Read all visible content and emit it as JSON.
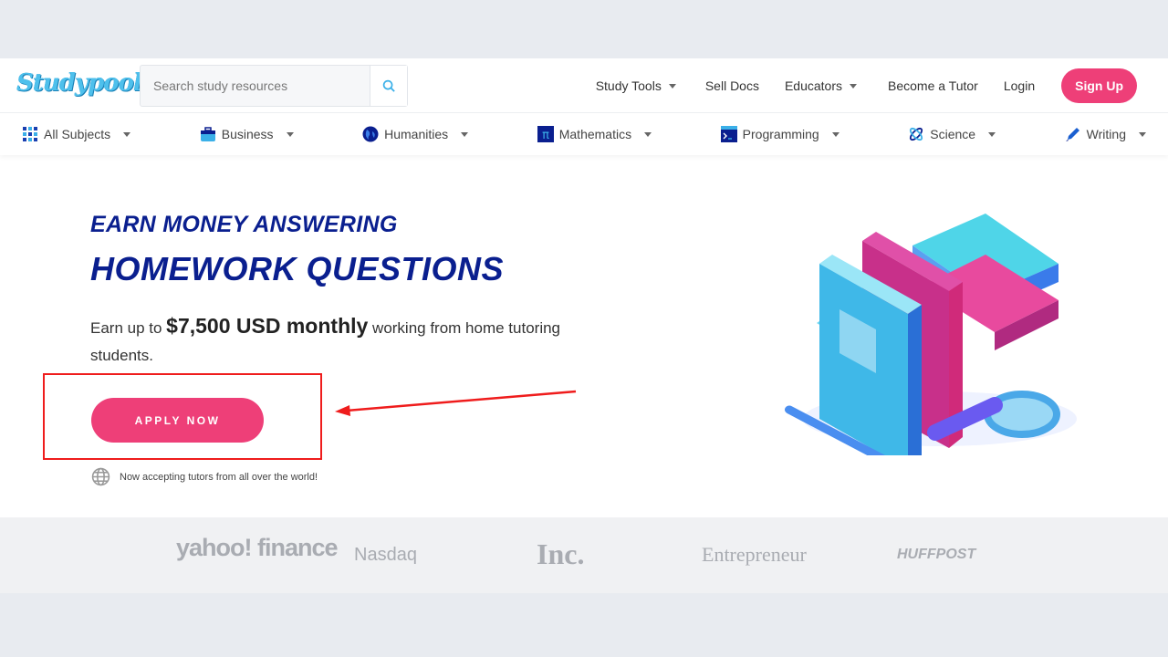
{
  "header": {
    "logo": "Studypool",
    "search_placeholder": "Search study resources",
    "nav": [
      {
        "label": "Study Tools",
        "dropdown": true
      },
      {
        "label": "Sell Docs",
        "dropdown": false
      },
      {
        "label": "Educators",
        "dropdown": true
      },
      {
        "label": "Become a Tutor",
        "dropdown": false
      },
      {
        "label": "Login",
        "dropdown": false
      }
    ],
    "signup": "Sign Up"
  },
  "subjects": [
    {
      "label": "All Subjects",
      "icon": "grid-icon"
    },
    {
      "label": "Business",
      "icon": "briefcase-icon"
    },
    {
      "label": "Humanities",
      "icon": "globe-icon"
    },
    {
      "label": "Mathematics",
      "icon": "pi-icon"
    },
    {
      "label": "Programming",
      "icon": "terminal-icon"
    },
    {
      "label": "Science",
      "icon": "atom-icon"
    },
    {
      "label": "Writing",
      "icon": "pencil-icon"
    }
  ],
  "hero": {
    "subtitle": "EARN MONEY ANSWERING",
    "title": "HOMEWORK QUESTIONS",
    "text_pre": "Earn up to ",
    "text_bold": "$7,500 USD monthly",
    "text_post": " working from home tutoring students.",
    "apply": "APPLY NOW",
    "note": "Now accepting tutors from all over the world!"
  },
  "press": [
    "yahoo! finance",
    "Nasdaq",
    "Inc.",
    "Entrepreneur",
    "HUFFPOST"
  ],
  "colors": {
    "accent": "#ee3f78",
    "title": "#0a1f8f",
    "annotation": "#ef1c1c"
  }
}
